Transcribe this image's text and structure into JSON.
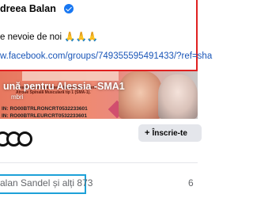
{
  "post": {
    "author": "dreea Balan",
    "text": "e nevoie de noi 🙏🙏🙏",
    "link": "w.facebook.com/groups/749355595491433/?ref=sha"
  },
  "shared_group": {
    "banner_caption": "Alessia poartă pe umeri diagnosticul crunt Atrofie Spinală Musculară tip 1 (SMA-1).",
    "banner_code_1": "IN: RO00BTRLRONCRT0532233601",
    "banner_code_2": "IN: RO00BTRLEURCRT0532233601",
    "title": "ună pentru Alessia -SMA1",
    "subtitle": "mbri",
    "join_button": "Înscrie-te"
  },
  "reactions": {
    "text": "alan Sandel și alți 873",
    "comment_count": "6"
  },
  "colors": {
    "highlight_red": "#e02020",
    "highlight_blue": "#1da1d8",
    "link_blue": "#1a56b8"
  }
}
